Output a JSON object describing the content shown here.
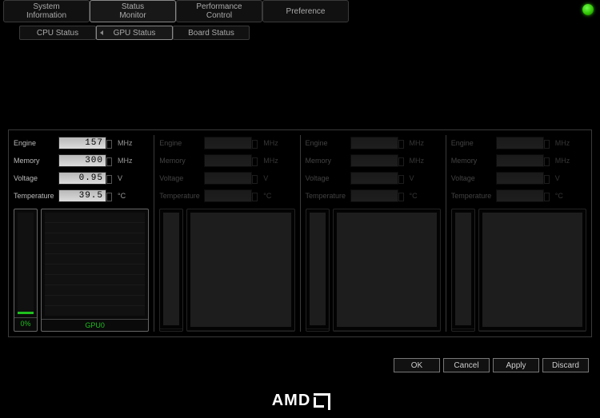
{
  "main_tabs": [
    {
      "label_line1": "System",
      "label_line2": "Information"
    },
    {
      "label_line1": "Status",
      "label_line2": "Monitor"
    },
    {
      "label_line1": "Performance",
      "label_line2": "Control"
    },
    {
      "label_line1": "Preference",
      "label_line2": ""
    }
  ],
  "main_tab_active_index": 1,
  "sub_tabs": [
    "CPU Status",
    "GPU Status",
    "Board Status"
  ],
  "sub_tab_active_index": 1,
  "stat_labels": {
    "engine": "Engine",
    "memory": "Memory",
    "voltage": "Voltage",
    "temperature": "Temperature"
  },
  "units": {
    "mhz": "MHz",
    "v": "V",
    "c": "°C"
  },
  "gpus": [
    {
      "active": true,
      "engine": "157",
      "memory": "300",
      "voltage": "0.95",
      "temperature": "39.5",
      "meter_pct": "0%",
      "graph_label": "GPU0",
      "meter_fill": 2
    },
    {
      "active": false,
      "engine": "",
      "memory": "",
      "voltage": "",
      "temperature": "",
      "meter_pct": "",
      "graph_label": "",
      "meter_fill": 0
    },
    {
      "active": false,
      "engine": "",
      "memory": "",
      "voltage": "",
      "temperature": "",
      "meter_pct": "",
      "graph_label": "",
      "meter_fill": 0
    },
    {
      "active": false,
      "engine": "",
      "memory": "",
      "voltage": "",
      "temperature": "",
      "meter_pct": "",
      "graph_label": "",
      "meter_fill": 0
    }
  ],
  "buttons": {
    "ok": "OK",
    "cancel": "Cancel",
    "apply": "Apply",
    "discard": "Discard"
  },
  "brand": "AMD"
}
